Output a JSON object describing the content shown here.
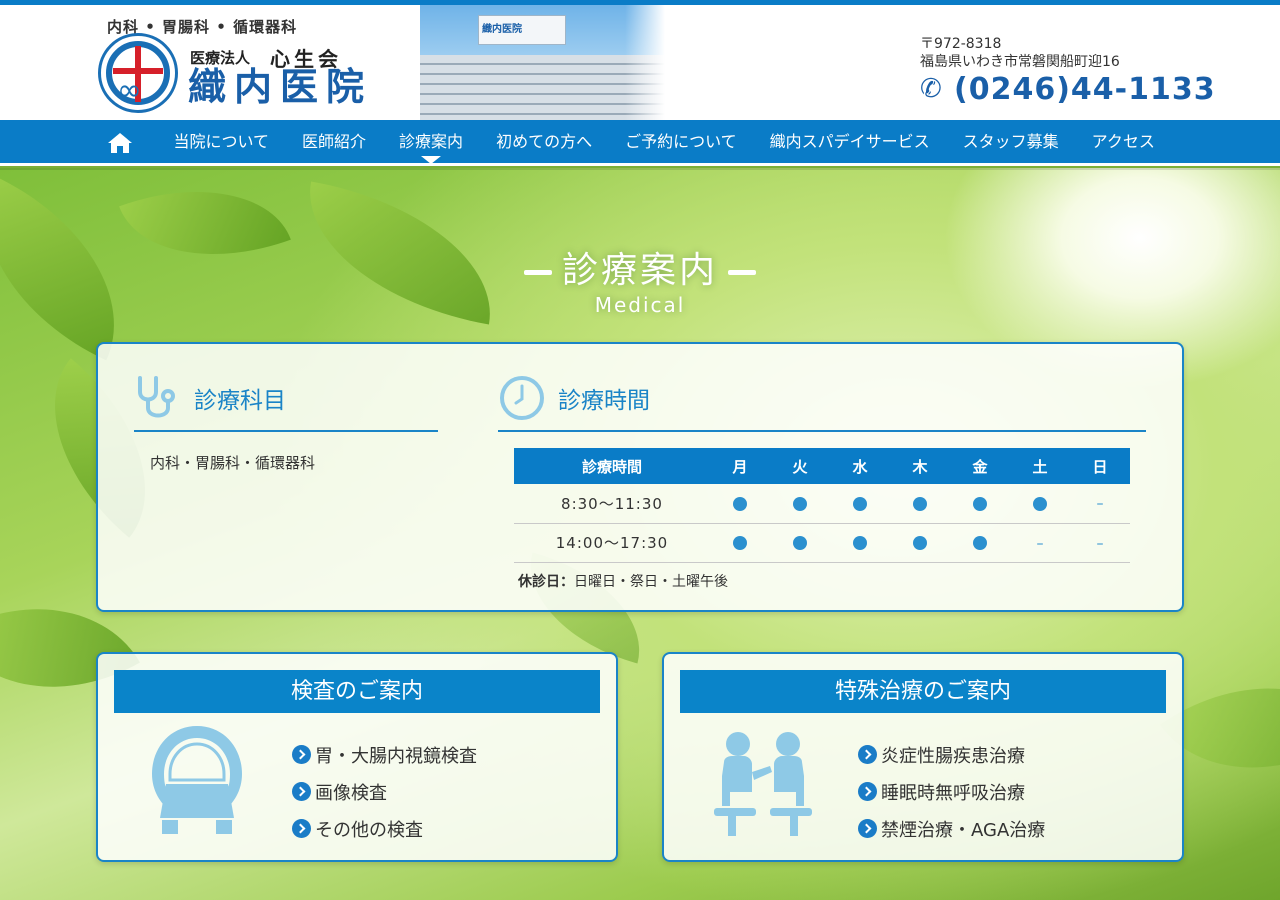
{
  "header": {
    "departments": "内科 • 胃腸科 • 循環器科",
    "corp_label": "医療法人",
    "corp_name": "心生会",
    "clinic_name": "織内医院",
    "building_sign": "織内医院",
    "zip": "〒972-8318",
    "address": "福島県いわき市常磐関船町迎16",
    "phone": "(0246)44-1133"
  },
  "nav": {
    "items": [
      {
        "label": "当院について"
      },
      {
        "label": "医師紹介"
      },
      {
        "label": "診療案内",
        "active": true
      },
      {
        "label": "初めての方へ"
      },
      {
        "label": "ご予約について"
      },
      {
        "label": "織内スパデイサービス"
      },
      {
        "label": "スタッフ募集"
      },
      {
        "label": "アクセス"
      }
    ]
  },
  "page": {
    "title": "診療案内",
    "subtitle": "Medical"
  },
  "departments": {
    "heading": "診療科目",
    "text": "内科・胃腸科・循環器科"
  },
  "hours": {
    "heading": "診療時間",
    "header_label": "診療時間",
    "days": [
      "月",
      "火",
      "水",
      "木",
      "金",
      "土",
      "日"
    ],
    "rows": [
      {
        "time": "8:30～11:30",
        "open": [
          true,
          true,
          true,
          true,
          true,
          true,
          false
        ]
      },
      {
        "time": "14:00～17:30",
        "open": [
          true,
          true,
          true,
          true,
          true,
          false,
          false
        ]
      }
    ],
    "open_mark": "●",
    "closed_mark": "–",
    "closed_label": "休診日：",
    "closed_days": "日曜日・祭日・土曜午後"
  },
  "exams": {
    "title": "検査のご案内",
    "items": [
      "胃・大腸内視鏡検査",
      "画像検査",
      "その他の検査"
    ]
  },
  "special": {
    "title": "特殊治療のご案内",
    "items": [
      "炎症性腸疾患治療",
      "睡眠時無呼吸治療",
      "禁煙治療・AGA治療"
    ]
  },
  "icons": {
    "home": "home-icon",
    "phone": "phone-icon",
    "stethoscope": "stethoscope-icon",
    "clock": "clock-icon",
    "mri": "mri-scanner-icon",
    "consultation": "consultation-icon",
    "chevron": "chevron-right-icon"
  },
  "colors": {
    "brand_blue": "#0a7cc7",
    "heading_blue": "#1a84c7",
    "cross_red": "#d6202a",
    "icon_light_blue": "#8ec9e6"
  }
}
